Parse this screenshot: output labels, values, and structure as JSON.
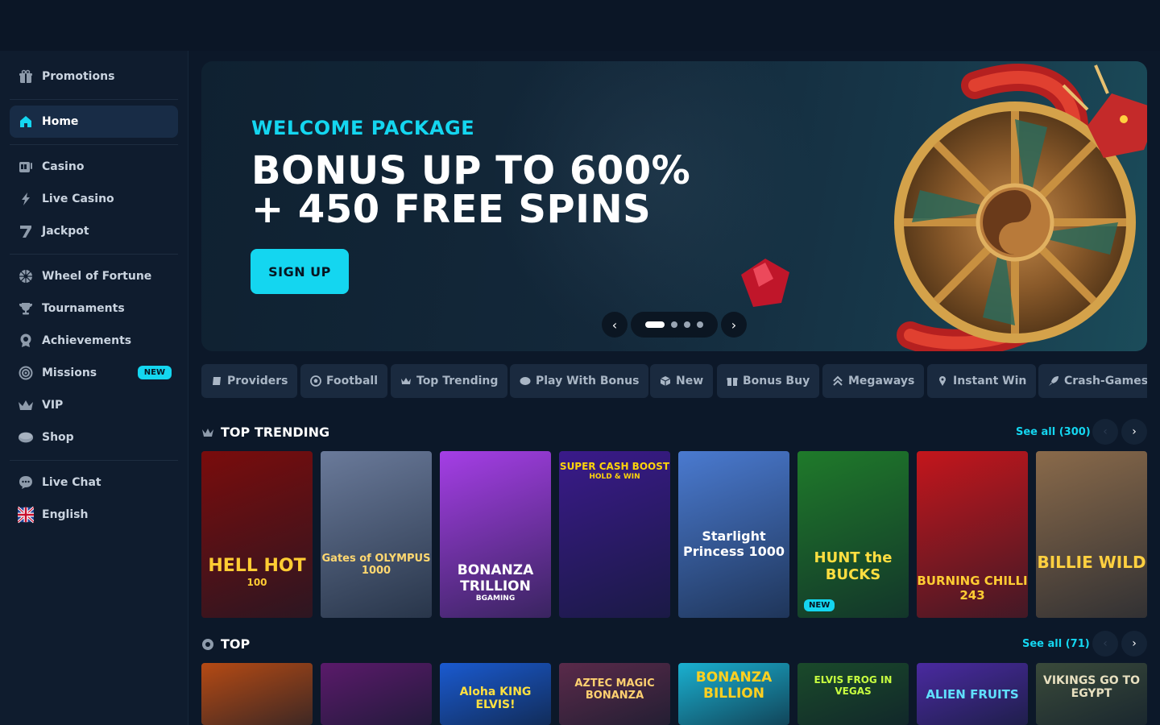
{
  "sidebar": {
    "items": [
      {
        "label": "Promotions"
      },
      {
        "label": "Home"
      },
      {
        "label": "Casino"
      },
      {
        "label": "Live Casino"
      },
      {
        "label": "Jackpot"
      },
      {
        "label": "Wheel of Fortune"
      },
      {
        "label": "Tournaments"
      },
      {
        "label": "Achievements"
      },
      {
        "label": "Missions",
        "badge": "NEW"
      },
      {
        "label": "VIP"
      },
      {
        "label": "Shop"
      },
      {
        "label": "Live Chat"
      },
      {
        "label": "English"
      }
    ]
  },
  "banner": {
    "subtitle": "WELCOME PACKAGE",
    "title_line1": "BONUS UP TO 600%",
    "title_line2": "+ 450 FREE SPINS",
    "cta": "SIGN UP",
    "slides_total": 4,
    "active_slide": 1
  },
  "tabs": [
    {
      "label": "Providers",
      "icon": "book-icon"
    },
    {
      "label": "Football",
      "icon": "football-icon"
    },
    {
      "label": "Top Trending",
      "icon": "crown-icon"
    },
    {
      "label": "Play With Bonus",
      "icon": "chat-bubble-icon"
    },
    {
      "label": "New",
      "icon": "box-icon"
    },
    {
      "label": "Bonus Buy",
      "icon": "gift-icon"
    },
    {
      "label": "Megaways",
      "icon": "chevrons-up-icon"
    },
    {
      "label": "Instant Win",
      "icon": "pin-icon"
    },
    {
      "label": "Crash-Games",
      "icon": "rocket-icon"
    }
  ],
  "sections": [
    {
      "title": "TOP TRENDING",
      "see_all": "See all (300)",
      "games": [
        {
          "name": "HELL HOT",
          "sub": "100",
          "bg": "#7a0c0c"
        },
        {
          "name": "Gates of OLYMPUS 1000",
          "sub": "",
          "bg": "#6a7a9a"
        },
        {
          "name": "BONANZA TRILLION",
          "sub": "BGAMING",
          "bg": "#a53ee6"
        },
        {
          "name": "SUPER CASH BOOST",
          "sub": "HOLD & WIN",
          "bg": "#3a1a8a"
        },
        {
          "name": "Starlight Princess 1000",
          "sub": "",
          "bg": "#4a7ad0"
        },
        {
          "name": "HUNT the BUCKS",
          "sub": "",
          "bg": "#1f7a2a",
          "badge": "NEW"
        },
        {
          "name": "BURNING CHILLI 243",
          "sub": "",
          "bg": "#c4161c"
        },
        {
          "name": "BILLIE WILD",
          "sub": "",
          "bg": "#8a6a4a"
        }
      ]
    },
    {
      "title": "TOP",
      "see_all": "See all (71)",
      "games": [
        {
          "name": "",
          "sub": "",
          "bg": "#b54a14"
        },
        {
          "name": "",
          "sub": "",
          "bg": "#5a1a6a"
        },
        {
          "name": "Aloha KING ELVIS!",
          "sub": "",
          "bg": "#1a5ad0"
        },
        {
          "name": "AZTEC MAGIC BONANZA",
          "sub": "",
          "bg": "#5a2a4a"
        },
        {
          "name": "BONANZA BILLION",
          "sub": "",
          "bg": "#1ab0d0"
        },
        {
          "name": "ELVIS FROG IN VEGAS",
          "sub": "",
          "bg": "#1a4a2a"
        },
        {
          "name": "ALIEN FRUITS",
          "sub": "",
          "bg": "#4a2aa0"
        },
        {
          "name": "VIKINGS GO TO EGYPT",
          "sub": "",
          "bg": "#3a4a3a"
        }
      ]
    }
  ]
}
